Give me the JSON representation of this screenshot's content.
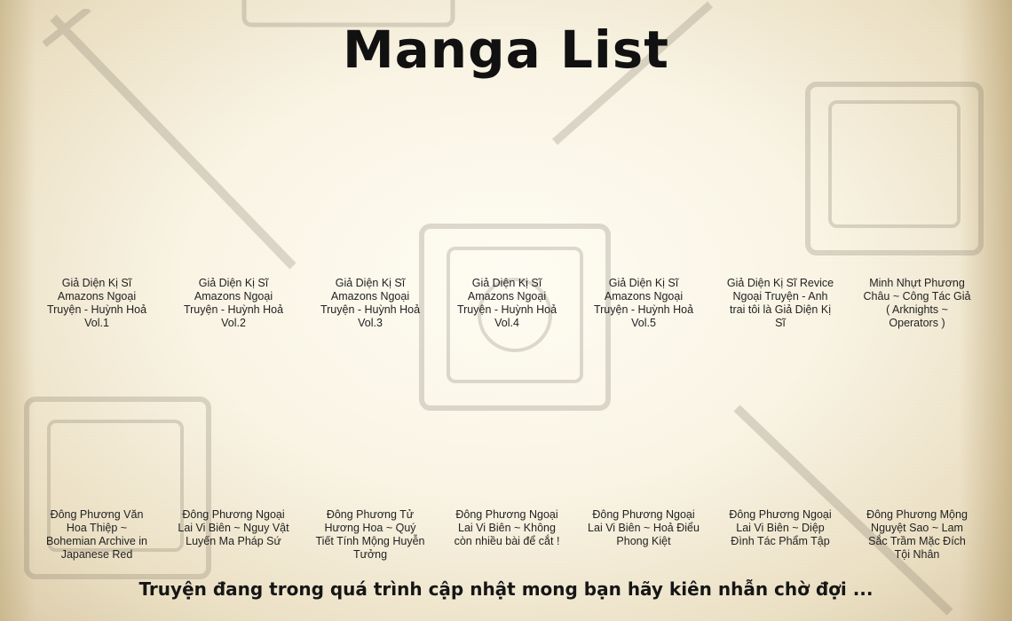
{
  "title": "Manga List",
  "rows": [
    [
      {
        "label": "Giả Diện Kị Sĩ Amazons Ngoại Truyện - Huỳnh Hoả Vol.1"
      },
      {
        "label": "Giả Diện Kị Sĩ Amazons Ngoại Truyện - Huỳnh Hoả Vol.2"
      },
      {
        "label": "Giả Diện Kị Sĩ Amazons Ngoại Truyện - Huỳnh Hoả Vol.3"
      },
      {
        "label": "Giả Diện Kị Sĩ Amazons Ngoại Truyện - Huỳnh Hoả Vol.4"
      },
      {
        "label": "Giả Diện Kị Sĩ Amazons Ngoại Truyện - Huỳnh Hoả Vol.5"
      },
      {
        "label": "Giả Diện Kị Sĩ Revice Ngoại Truyện - Anh trai tôi là Giả Diện Kị Sĩ"
      },
      {
        "label": "Minh Nhựt Phương Châu ~ Công Tác Giả ( Arknights ~ Operators )"
      }
    ],
    [
      {
        "label": "Đông Phương Văn Hoa Thiệp ~ Bohemian Archive in Japanese Red"
      },
      {
        "label": "Đông Phương Ngoại Lai Vi Biên ~ Nguy Vật Luyến Ma Pháp Sứ"
      },
      {
        "label": "Đông Phương Tử Hương Hoa ~ Quý Tiết Tính Mộng Huyễn Tưởng"
      },
      {
        "label": "Đông Phương Ngoại Lai Vi Biên ~ Không còn nhiều bài để cắt !"
      },
      {
        "label": "Đông Phương Ngoại Lai Vi Biên ~ Hoả Điểu Phong Kiệt"
      },
      {
        "label": "Đông Phương Ngoại Lai Vi Biên ~ Diệp Đình Tác Phẩm Tập"
      },
      {
        "label": "Đông Phương Mộng Nguyệt Sao ~ Lam Sắc Trầm Mặc Đích Tội Nhân"
      }
    ]
  ],
  "footer": "Truyện đang trong quá trình cập nhật mong bạn hãy kiên nhẫn chờ đợi ..."
}
